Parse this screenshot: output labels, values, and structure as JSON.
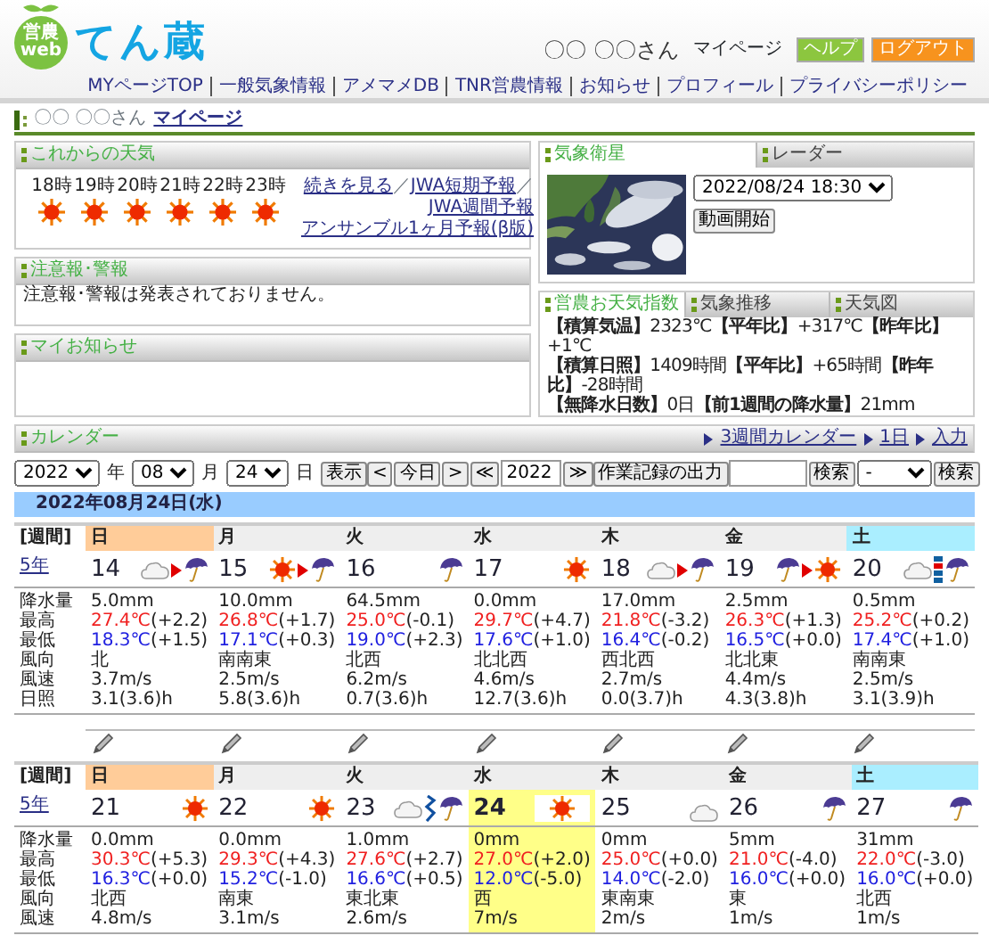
{
  "header": {
    "logo_badge": [
      "営農",
      "web"
    ],
    "logo_text": "てん蔵",
    "user": "〇〇 〇〇さん",
    "mypage": "マイページ",
    "buttons": [
      {
        "label": "ヘルプ",
        "color": "#8cc63f"
      },
      {
        "label": "ログアウト",
        "color": "#f7931e"
      }
    ],
    "nav": [
      "MYページTOP",
      "一般気象情報",
      "アメマメDB",
      "TNR営農情報",
      "お知らせ",
      "プロフィール",
      "プライバシーポリシー"
    ]
  },
  "breadcrumb": {
    "user": "〇〇 〇〇さん",
    "link": "マイページ"
  },
  "forecast": {
    "title": "これからの天気",
    "hours": [
      {
        "time": "18時",
        "kind": "sun"
      },
      {
        "time": "19時",
        "kind": "sun"
      },
      {
        "time": "20時",
        "kind": "sun"
      },
      {
        "time": "21時",
        "kind": "sun"
      },
      {
        "time": "22時",
        "kind": "sun"
      },
      {
        "time": "23時",
        "kind": "sun"
      }
    ],
    "links": [
      "続きを見る",
      "JWA短期予報",
      "JWA週間予報"
    ],
    "separator": "／",
    "extra_link": "アンサンブル1ヶ月予報(β版)"
  },
  "warnings": {
    "title": "注意報･警報",
    "text": "注意報･警報は発表されておりません。"
  },
  "notices": {
    "title": "マイお知らせ"
  },
  "satellite": {
    "tabs": [
      {
        "label": "気象衛星",
        "selected": true
      },
      {
        "label": "レーダー",
        "selected": false
      }
    ],
    "time_select": "2022/08/24 18:30",
    "play_button": "動画開始"
  },
  "indices": {
    "tabs": [
      {
        "label": "営農お天気指数",
        "selected": true
      },
      {
        "label": "気象推移",
        "selected": false
      },
      {
        "label": "天気図",
        "selected": false
      }
    ],
    "lines": [
      "**【積算気温】**2323℃**【平年比】**+317℃**【昨年比】**+1℃",
      "**【積算日照】**1409時間**【平年比】**+65時間**【昨年比】**-28時間",
      "**【無降水日数】**0日**【前1週間の降水量】**21mm"
    ]
  },
  "calendar": {
    "title": "カレンダー",
    "links": [
      "3週間カレンダー",
      "1日",
      "入力"
    ],
    "controls": {
      "year": "2022",
      "year_unit": "年",
      "month": "08",
      "month_unit": "月",
      "day": "24",
      "day_unit": "日",
      "show_button": "表示",
      "prev_button": "<",
      "today_button": "今日",
      "next_button": ">",
      "prev_year_button": "≪",
      "year_field": "2022",
      "next_year_button": "≫",
      "export_button": "作業記録の出力",
      "search_button": "検索",
      "filter_select": "-",
      "filter_button": "検索"
    },
    "date_bar": "2022年08月24日(水)",
    "weeks": [
      {
        "label": "[週間]",
        "link": "5年",
        "edit_icons": true,
        "weekdays": [
          {
            "label": "日",
            "color": "#ffcc99"
          },
          {
            "label": "月",
            "color": "#eeeeee"
          },
          {
            "label": "火",
            "color": "#eeeeee"
          },
          {
            "label": "水",
            "color": "#eeeeee"
          },
          {
            "label": "木",
            "color": "#eeeeee"
          },
          {
            "label": "金",
            "color": "#eeeeee"
          },
          {
            "label": "土",
            "color": "#aaeeff"
          }
        ],
        "row_labels": [
          "降水量",
          "最高",
          "最低",
          "風向",
          "風速",
          "日照"
        ],
        "days": [
          {
            "date": "14",
            "selected": false,
            "weather": [
              {
                "kind": "cloud"
              },
              {
                "kind": "then"
              },
              {
                "kind": "rain"
              }
            ],
            "rain": "5.0mm",
            "high": "27.4℃",
            "high_diff": "(+2.2)",
            "low": "18.3℃",
            "low_diff": "(+1.5)",
            "wind_dir": "北",
            "wind_speed": "3.7m/s",
            "sunshine": "3.1(3.6)h"
          },
          {
            "date": "15",
            "selected": false,
            "weather": [
              {
                "kind": "sun"
              },
              {
                "kind": "then"
              },
              {
                "kind": "rain"
              }
            ],
            "rain": "10.0mm",
            "high": "26.8℃",
            "high_diff": "(+1.7)",
            "low": "17.1℃",
            "low_diff": "(+0.3)",
            "wind_dir": "南南東",
            "wind_speed": "2.5m/s",
            "sunshine": "5.8(3.6)h"
          },
          {
            "date": "16",
            "selected": false,
            "weather": [
              {
                "kind": "rain"
              }
            ],
            "rain": "64.5mm",
            "high": "25.0℃",
            "high_diff": "(-0.1)",
            "low": "19.0℃",
            "low_diff": "(+2.3)",
            "wind_dir": "北西",
            "wind_speed": "6.2m/s",
            "sunshine": "0.7(3.6)h"
          },
          {
            "date": "17",
            "selected": false,
            "weather": [
              {
                "kind": "sun"
              }
            ],
            "rain": "0.0mm",
            "high": "29.7℃",
            "high_diff": "(+4.7)",
            "low": "17.6℃",
            "low_diff": "(+1.0)",
            "wind_dir": "北北西",
            "wind_speed": "4.6m/s",
            "sunshine": "12.7(3.6)h"
          },
          {
            "date": "18",
            "selected": false,
            "weather": [
              {
                "kind": "cloud"
              },
              {
                "kind": "then"
              },
              {
                "kind": "rain"
              }
            ],
            "rain": "17.0mm",
            "high": "21.8℃",
            "high_diff": "(-3.2)",
            "low": "16.4℃",
            "low_diff": "(-0.2)",
            "wind_dir": "西北西",
            "wind_speed": "2.7m/s",
            "sunshine": "0.0(3.7)h"
          },
          {
            "date": "19",
            "selected": false,
            "weather": [
              {
                "kind": "rain"
              },
              {
                "kind": "then"
              },
              {
                "kind": "sun"
              }
            ],
            "rain": "2.5mm",
            "high": "26.3℃",
            "high_diff": "(+1.3)",
            "low": "16.5℃",
            "low_diff": "(+0.0)",
            "wind_dir": "北北東",
            "wind_speed": "4.4m/s",
            "sunshine": "4.3(3.8)h"
          },
          {
            "date": "20",
            "selected": false,
            "weather": [
              {
                "kind": "cloud"
              },
              {
                "kind": "sometimes"
              },
              {
                "kind": "rain"
              }
            ],
            "rain": "0.5mm",
            "high": "25.2℃",
            "high_diff": "(+0.2)",
            "low": "17.4℃",
            "low_diff": "(+1.0)",
            "wind_dir": "南南東",
            "wind_speed": "2.5m/s",
            "sunshine": "3.1(3.9)h"
          }
        ]
      },
      {
        "label": "[週間]",
        "link": "5年",
        "weekdays": [
          {
            "label": "日",
            "color": "#ffcc99"
          },
          {
            "label": "月",
            "color": "#eeeeee"
          },
          {
            "label": "火",
            "color": "#eeeeee"
          },
          {
            "label": "水",
            "color": "#eeeeee"
          },
          {
            "label": "木",
            "color": "#eeeeee"
          },
          {
            "label": "金",
            "color": "#eeeeee"
          },
          {
            "label": "土",
            "color": "#aaeeff"
          }
        ],
        "row_labels": [
          "降水量",
          "最高",
          "最低",
          "風向",
          "風速"
        ],
        "days": [
          {
            "date": "21",
            "selected": false,
            "weather": [
              {
                "kind": "sun"
              }
            ],
            "rain": "0.0mm",
            "high": "30.3℃",
            "high_diff": "(+5.3)",
            "low": "16.3℃",
            "low_diff": "(+0.0)",
            "wind_dir": "北西",
            "wind_speed": "4.8m/s"
          },
          {
            "date": "22",
            "selected": false,
            "weather": [
              {
                "kind": "sun"
              }
            ],
            "rain": "0.0mm",
            "high": "29.3℃",
            "high_diff": "(+4.3)",
            "low": "15.2℃",
            "low_diff": "(-1.0)",
            "wind_dir": "南東",
            "wind_speed": "3.1m/s"
          },
          {
            "date": "23",
            "selected": false,
            "weather": [
              {
                "kind": "cloud"
              },
              {
                "kind": "changing"
              },
              {
                "kind": "rain"
              }
            ],
            "rain": "1.0mm",
            "high": "27.6℃",
            "high_diff": "(+2.7)",
            "low": "16.6℃",
            "low_diff": "(+0.5)",
            "wind_dir": "東北東",
            "wind_speed": "2.6m/s"
          },
          {
            "date": "24",
            "selected": true,
            "weather": [
              {
                "kind": "sun"
              }
            ],
            "rain": "0mm",
            "high": "27.0℃",
            "high_diff": "(+2.0)",
            "low": "12.0℃",
            "low_diff": "(-5.0)",
            "wind_dir": "西",
            "wind_speed": "7m/s"
          },
          {
            "date": "25",
            "selected": false,
            "weather": [
              {
                "kind": "cloud"
              }
            ],
            "rain": "0mm",
            "high": "25.0℃",
            "high_diff": "(+0.0)",
            "low": "14.0℃",
            "low_diff": "(-2.0)",
            "wind_dir": "東南東",
            "wind_speed": "2m/s"
          },
          {
            "date": "26",
            "selected": false,
            "weather": [
              {
                "kind": "rain"
              }
            ],
            "rain": "5mm",
            "high": "21.0℃",
            "high_diff": "(-4.0)",
            "low": "16.0℃",
            "low_diff": "(+0.0)",
            "wind_dir": "東",
            "wind_speed": "1m/s"
          },
          {
            "date": "27",
            "selected": false,
            "weather": [
              {
                "kind": "rain"
              }
            ],
            "rain": "31mm",
            "high": "22.0℃",
            "high_diff": "(-3.0)",
            "low": "16.0℃",
            "low_diff": "(+0.0)",
            "wind_dir": "北西",
            "wind_speed": "1m/s"
          }
        ]
      }
    ]
  }
}
